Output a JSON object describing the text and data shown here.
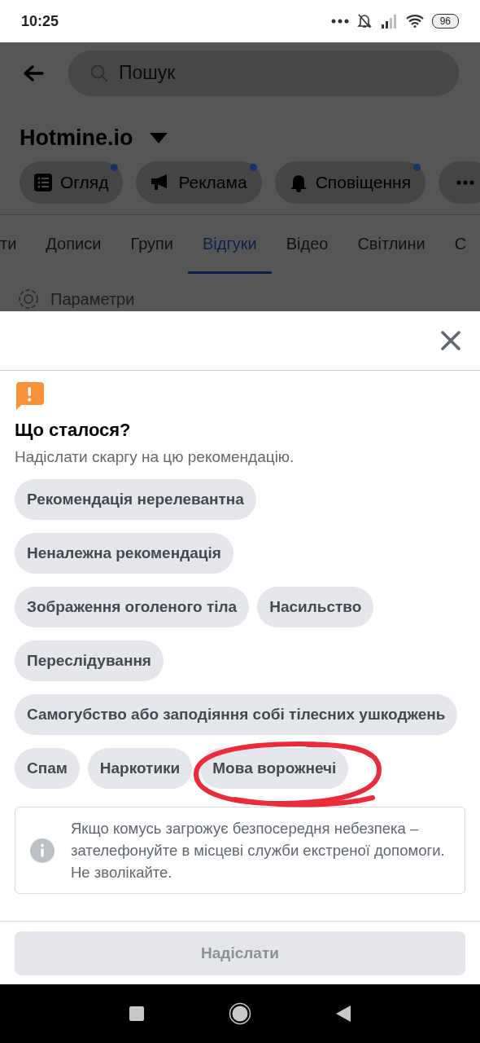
{
  "status_bar": {
    "time": "10:25",
    "battery": "96"
  },
  "background_page": {
    "search": {
      "placeholder": "Пошук"
    },
    "title": "Hotmine.io",
    "chips": [
      {
        "kind": "list",
        "label": "Огляд",
        "badge": true
      },
      {
        "kind": "megaphone",
        "label": "Реклама",
        "badge": true
      },
      {
        "kind": "bell",
        "label": "Сповіщення",
        "badge": true
      },
      {
        "kind": "more"
      }
    ],
    "tabs": [
      {
        "label": "ти",
        "selected": false
      },
      {
        "label": "Дописи",
        "selected": false
      },
      {
        "label": "Групи",
        "selected": false
      },
      {
        "label": "Відгуки",
        "selected": true
      },
      {
        "label": "Відео",
        "selected": false
      },
      {
        "label": "Світлини",
        "selected": false
      },
      {
        "label": "С",
        "selected": false
      }
    ],
    "settings_label": "Параметри"
  },
  "sheet": {
    "heading": "Що сталося?",
    "subtitle": "Надіслати скаргу на цю рекомендацію.",
    "reasons": [
      {
        "label": "Рекомендація нерелевантна"
      },
      {
        "label": "Неналежна рекомендація"
      },
      {
        "label": "Зображення оголеного тіла"
      },
      {
        "label": "Насильство"
      },
      {
        "label": "Переслідування"
      },
      {
        "label": "Самогубство або заподіяння собі тілесних ушкоджень"
      },
      {
        "label": "Спам"
      },
      {
        "label": "Наркотики"
      },
      {
        "label": "Мова ворожнечі"
      }
    ],
    "notice": "Якщо комусь загрожує безпосередня небезпека – зателефонуйте в місцеві служби екстреної допомоги. Не зволікайте.",
    "submit": {
      "label": "Надіслати",
      "disabled": true
    }
  }
}
